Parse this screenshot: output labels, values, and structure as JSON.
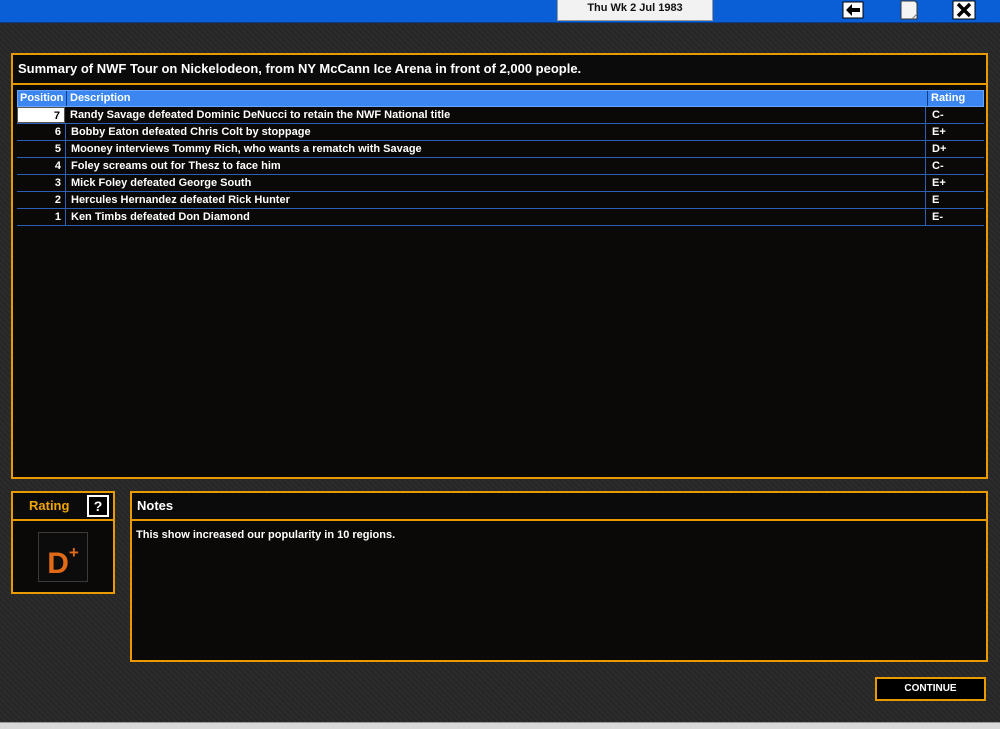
{
  "topbar": {
    "date": "Thu Wk 2 Jul 1983",
    "icons": [
      "back-arrow-icon",
      "document-icon",
      "close-icon"
    ]
  },
  "summary": {
    "title": "Summary of NWF Tour on Nickelodeon, from NY McCann Ice Arena in front of 2,000 people.",
    "columns": {
      "position": "Position",
      "description": "Description",
      "rating": "Rating"
    },
    "rows": [
      {
        "position": "7",
        "description": "Randy Savage defeated Dominic DeNucci to retain the NWF National title",
        "rating": "C-"
      },
      {
        "position": "6",
        "description": "Bobby Eaton defeated Chris Colt by stoppage",
        "rating": "E+"
      },
      {
        "position": "5",
        "description": "Mooney interviews Tommy Rich, who wants a rematch with Savage",
        "rating": "D+"
      },
      {
        "position": "4",
        "description": "Foley screams out for Thesz to face him",
        "rating": "C-"
      },
      {
        "position": "3",
        "description": "Mick Foley defeated George South",
        "rating": "E+"
      },
      {
        "position": "2",
        "description": "Hercules Hernandez defeated Rick Hunter",
        "rating": "E"
      },
      {
        "position": "1",
        "description": "Ken Timbs defeated Don Diamond",
        "rating": "E-"
      }
    ]
  },
  "rating_panel": {
    "title": "Rating",
    "help": "?",
    "grade_letter": "D",
    "grade_modifier": "+"
  },
  "notes": {
    "title": "Notes",
    "text": "This show increased our popularity in 10 regions."
  },
  "continue_label": "CONTINUE",
  "colors": {
    "accent": "#e89a00",
    "topbar": "#0a5fd6",
    "header": "#3b86f0",
    "grade": "#e06a16"
  }
}
